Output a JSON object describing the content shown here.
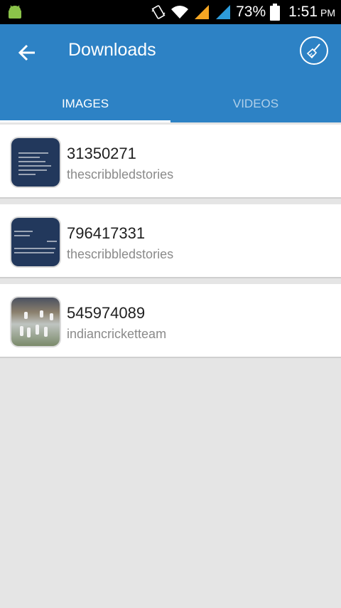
{
  "status_bar": {
    "battery": "73%",
    "time": "1:51",
    "ampm": "PM",
    "icons": [
      "android-icon",
      "vibrate-icon",
      "wifi-icon",
      "signal-icon",
      "signal-icon",
      "battery-icon"
    ]
  },
  "appbar": {
    "title": "Downloads",
    "back_icon": "arrow-left-icon",
    "clean_icon": "broom-icon",
    "color": "#2d82c5"
  },
  "tabs": [
    {
      "label": "IMAGES",
      "active": true
    },
    {
      "label": "VIDEOS",
      "active": false
    }
  ],
  "items": [
    {
      "title": "31350271",
      "subtitle": "thescribbledstories",
      "thumb": "text-image"
    },
    {
      "title": "796417331",
      "subtitle": "thescribbledstories",
      "thumb": "text-image"
    },
    {
      "title": "545974089",
      "subtitle": "indiancricketteam",
      "thumb": "cricket-photo"
    }
  ]
}
